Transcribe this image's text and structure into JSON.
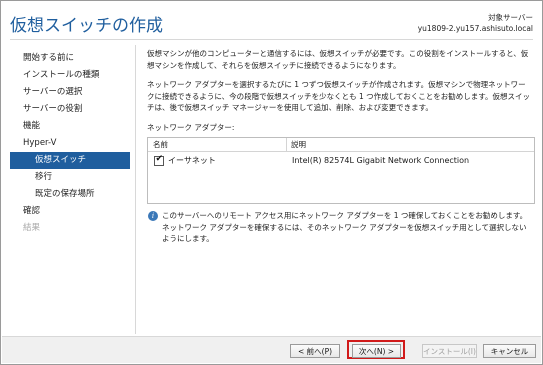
{
  "window": {
    "title": "仮想スイッチの作成",
    "target_label": "対象サーバー",
    "target_server": "yu1809-2.yu157.ashisuto.local"
  },
  "nav": {
    "items": [
      {
        "label": "開始する前に",
        "state": "normal"
      },
      {
        "label": "インストールの種類",
        "state": "normal"
      },
      {
        "label": "サーバーの選択",
        "state": "normal"
      },
      {
        "label": "サーバーの役割",
        "state": "normal"
      },
      {
        "label": "機能",
        "state": "normal"
      },
      {
        "label": "Hyper-V",
        "state": "normal"
      },
      {
        "label": "仮想スイッチ",
        "state": "selected"
      },
      {
        "label": "移行",
        "state": "normal"
      },
      {
        "label": "既定の保存場所",
        "state": "normal"
      },
      {
        "label": "確認",
        "state": "normal"
      },
      {
        "label": "結果",
        "state": "disabled"
      }
    ]
  },
  "main": {
    "para1": "仮想マシンが他のコンピューターと通信するには、仮想スイッチが必要です。この役割をインストールすると、仮想マシンを作成して、それらを仮想スイッチに接続できるようになります。",
    "para2": "ネットワーク アダプターを選択するたびに 1 つずつ仮想スイッチが作成されます。仮想マシンで物理ネットワークに接続できるように、今の段階で仮想スイッチを少なくとも 1 つ作成しておくことをお勧めします。仮想スイッチは、後で仮想スイッチ マネージャーを使用して追加、削除、および変更できます。",
    "adapters_label": "ネットワーク アダプター:"
  },
  "table": {
    "columns": [
      "名前",
      "説明"
    ],
    "rows": [
      {
        "checked": true,
        "check_glyph": "✔",
        "name": "イーサネット",
        "description": "Intel(R) 82574L Gigabit Network Connection"
      }
    ]
  },
  "info": {
    "icon_glyph": "i",
    "text": "このサーバーへのリモート アクセス用にネットワーク アダプターを 1 つ確保しておくことをお勧めします。ネットワーク アダプターを確保するには、そのネットワーク アダプターを仮想スイッチ用として選択しないようにします。"
  },
  "buttons": {
    "prev": "< 前へ(P)",
    "next": "次へ(N) >",
    "install": "インストール(I)",
    "cancel": "キャンセル"
  },
  "colors": {
    "accent": "#1f5e9e",
    "highlight_box": "#d11a1a"
  }
}
